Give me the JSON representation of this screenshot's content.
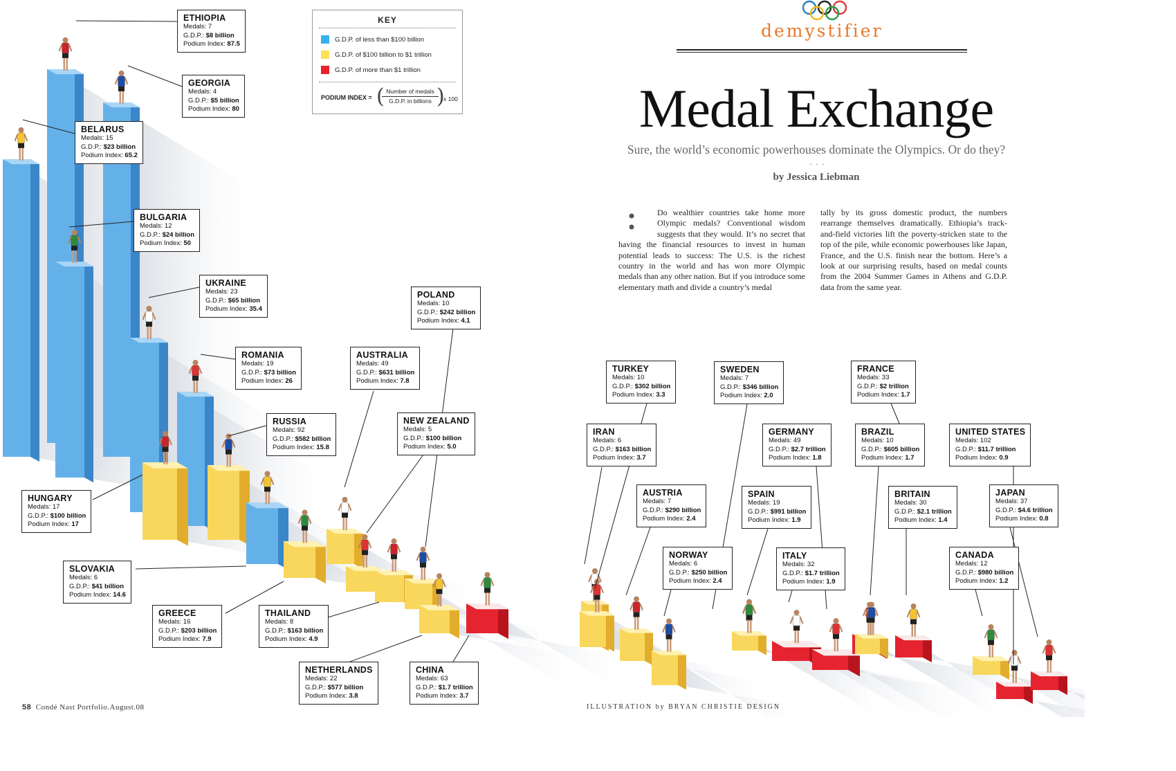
{
  "rubric": "demystifier",
  "title": "Medal Exchange",
  "dek": "Sure, the world’s economic powerhouses dominate the Olympics. Or do they?",
  "ellipsis": "· · ·",
  "byline": "by Jessica Liebman",
  "body_col1": "Do wealthier countries take home more Olympic medals? Conventional wisdom suggests that they would. It’s no secret that having the financial resources to invest in human potential leads to success: The U.S. is the richest country in the world and has won more Olympic medals than any other nation. But if you introduce some elementary math and divide a country’s medal",
  "body_col2": "tally by its gross domestic product, the numbers rearrange themselves dramatically. Ethiopia’s track-and-field victories lift the poverty-stricken state to the top of the pile, while economic powerhouses like Japan, France, and the U.S. finish near the bottom. Here’s a look at our surprising results, based on medal counts from the 2004 Summer Games in Athens and G.D.P. data from the same year.",
  "folio": {
    "page": "58",
    "text": "Condé Nast Portfolio.August.08"
  },
  "credit": "ILLUSTRATION by BRYAN CHRISTIE DESIGN",
  "key": {
    "title": "KEY",
    "items": [
      {
        "label": "G.D.P. of less than $100 billion",
        "color": "#35b2ea"
      },
      {
        "label": "G.D.P. of $100 billion to $1 trillion",
        "color": "#fde057"
      },
      {
        "label": "G.D.P. of more than $1 trillion",
        "color": "#ec2028"
      }
    ],
    "formula_label": "PODIUM INDEX =",
    "numerator": "Number of medals",
    "denominator": "G.D.P. in billions",
    "multiplier": "x 100"
  },
  "labels": {
    "medals": "Medals:",
    "gdp": "G.D.P.:",
    "podium_index": "Podium Index:"
  },
  "colors": {
    "blue": "#5aa9e6",
    "yellow": "#f7d154",
    "red": "#e4232e",
    "accent": "#e6782a"
  },
  "countries": [
    {
      "name": "ETHIOPIA",
      "medals": "7",
      "gdp": "$8 billion",
      "index": "87.5",
      "tier": "blue"
    },
    {
      "name": "GEORGIA",
      "medals": "4",
      "gdp": "$5 billion",
      "index": "80",
      "tier": "blue"
    },
    {
      "name": "BELARUS",
      "medals": "15",
      "gdp": "$23 billion",
      "index": "65.2",
      "tier": "blue"
    },
    {
      "name": "BULGARIA",
      "medals": "12",
      "gdp": "$24 billion",
      "index": "50",
      "tier": "blue"
    },
    {
      "name": "UKRAINE",
      "medals": "23",
      "gdp": "$65 billion",
      "index": "35.4",
      "tier": "blue"
    },
    {
      "name": "ROMANIA",
      "medals": "19",
      "gdp": "$73 billion",
      "index": "26",
      "tier": "blue"
    },
    {
      "name": "HUNGARY",
      "medals": "17",
      "gdp": "$100 billion",
      "index": "17",
      "tier": "yellow"
    },
    {
      "name": "RUSSIA",
      "medals": "92",
      "gdp": "$582 billion",
      "index": "15.8",
      "tier": "yellow"
    },
    {
      "name": "SLOVAKIA",
      "medals": "6",
      "gdp": "$41 billion",
      "index": "14.6",
      "tier": "blue"
    },
    {
      "name": "GREECE",
      "medals": "16",
      "gdp": "$203 billion",
      "index": "7.9",
      "tier": "yellow"
    },
    {
      "name": "AUSTRALIA",
      "medals": "49",
      "gdp": "$631 billion",
      "index": "7.8",
      "tier": "yellow"
    },
    {
      "name": "NEW ZEALAND",
      "medals": "5",
      "gdp": "$100 billion",
      "index": "5.0",
      "tier": "yellow"
    },
    {
      "name": "THAILAND",
      "medals": "8",
      "gdp": "$163 billion",
      "index": "4.9",
      "tier": "yellow"
    },
    {
      "name": "POLAND",
      "medals": "10",
      "gdp": "$242 billion",
      "index": "4.1",
      "tier": "yellow"
    },
    {
      "name": "NETHERLANDS",
      "medals": "22",
      "gdp": "$577 billion",
      "index": "3.8",
      "tier": "yellow"
    },
    {
      "name": "CHINA",
      "medals": "63",
      "gdp": "$1.7 trillion",
      "index": "3.7",
      "tier": "red"
    },
    {
      "name": "IRAN",
      "medals": "6",
      "gdp": "$163 billion",
      "index": "3.7",
      "tier": "yellow"
    },
    {
      "name": "TURKEY",
      "medals": "10",
      "gdp": "$302 billion",
      "index": "3.3",
      "tier": "yellow"
    },
    {
      "name": "AUSTRIA",
      "medals": "7",
      "gdp": "$290 billion",
      "index": "2.4",
      "tier": "yellow"
    },
    {
      "name": "NORWAY",
      "medals": "6",
      "gdp": "$250 billion",
      "index": "2.4",
      "tier": "yellow"
    },
    {
      "name": "SWEDEN",
      "medals": "7",
      "gdp": "$346 billion",
      "index": "2.0",
      "tier": "yellow"
    },
    {
      "name": "SPAIN",
      "medals": "19",
      "gdp": "$991 billion",
      "index": "1.9",
      "tier": "yellow"
    },
    {
      "name": "ITALY",
      "medals": "32",
      "gdp": "$1.7 trillion",
      "index": "1.9",
      "tier": "red"
    },
    {
      "name": "GERMANY",
      "medals": "49",
      "gdp": "$2.7 trillion",
      "index": "1.8",
      "tier": "red"
    },
    {
      "name": "FRANCE",
      "medals": "33",
      "gdp": "$2 trillion",
      "index": "1.7",
      "tier": "red"
    },
    {
      "name": "BRAZIL",
      "medals": "10",
      "gdp": "$605 billion",
      "index": "1.7",
      "tier": "yellow"
    },
    {
      "name": "BRITAIN",
      "medals": "30",
      "gdp": "$2.1 trillion",
      "index": "1.4",
      "tier": "red"
    },
    {
      "name": "CANADA",
      "medals": "12",
      "gdp": "$980 billion",
      "index": "1.2",
      "tier": "yellow"
    },
    {
      "name": "UNITED STATES",
      "medals": "102",
      "gdp": "$11.7 trillion",
      "index": "0.9",
      "tier": "red"
    },
    {
      "name": "JAPAN",
      "medals": "37",
      "gdp": "$4.6 trillion",
      "index": "0.8",
      "tier": "red"
    }
  ]
}
